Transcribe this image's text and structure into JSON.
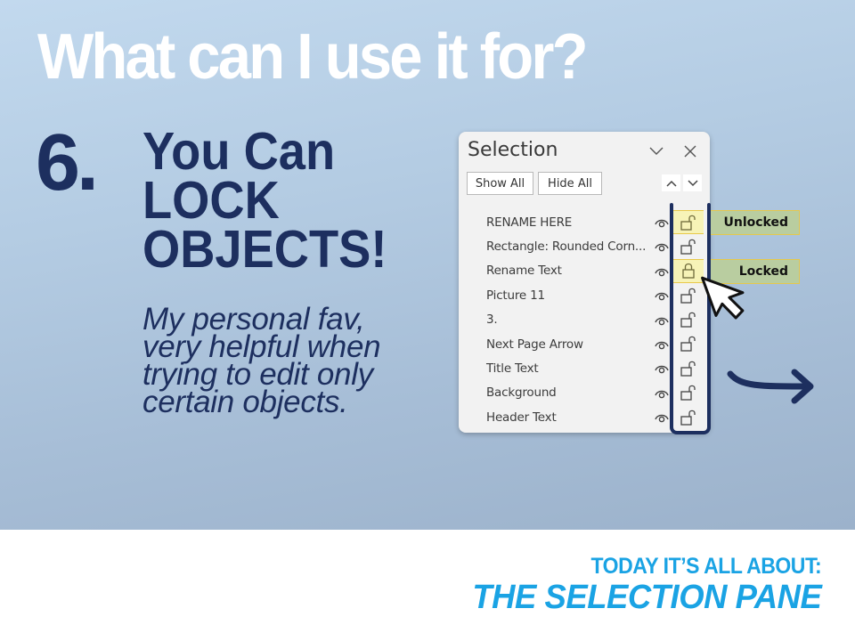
{
  "slide": {
    "title": "What can I use it for?",
    "tip_number": "6.",
    "heading_lines": [
      "You Can",
      "LOCK",
      "OBJECTS!"
    ],
    "description_lines": [
      "My personal fav,",
      "very helpful when",
      "trying to edit only",
      "certain objects."
    ],
    "footer": {
      "line1": "TODAY IT’S ALL ABOUT:",
      "line2": "THE SELECTION PANE"
    },
    "colors": {
      "navy": "#1d2f5f",
      "accent_blue": "#1aa3e4",
      "callout_green": "#b9cda0",
      "lock_highlight": "#f7f3b7"
    }
  },
  "selection_pane": {
    "title": "Selection",
    "collapse_icon": "chevron-down-icon",
    "close_icon": "close-icon",
    "show_all_label": "Show All",
    "hide_all_label": "Hide All",
    "bring_forward_icon": "chevron-up-icon",
    "send_backward_icon": "chevron-down-icon",
    "items": [
      {
        "name": "RENAME HERE",
        "visible": true,
        "locked": false,
        "highlight": true
      },
      {
        "name": "Rectangle: Rounded Corn...",
        "visible": true,
        "locked": false,
        "highlight": false
      },
      {
        "name": "Rename Text",
        "visible": true,
        "locked": true,
        "highlight": true
      },
      {
        "name": "Picture 11",
        "visible": true,
        "locked": false,
        "highlight": false
      },
      {
        "name": "3.",
        "visible": true,
        "locked": false,
        "highlight": false
      },
      {
        "name": "Next Page Arrow",
        "visible": true,
        "locked": false,
        "highlight": false
      },
      {
        "name": "Title Text",
        "visible": true,
        "locked": false,
        "highlight": false
      },
      {
        "name": "Background",
        "visible": true,
        "locked": false,
        "highlight": false
      },
      {
        "name": "Header Text",
        "visible": true,
        "locked": false,
        "highlight": false
      }
    ]
  },
  "callouts": {
    "unlocked": "Unlocked",
    "locked": "Locked"
  }
}
